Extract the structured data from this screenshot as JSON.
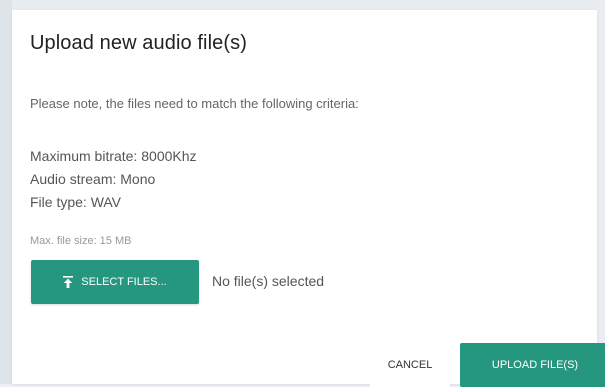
{
  "dialog": {
    "title": "Upload new audio file(s)",
    "note": "Please note, the files need to match the following criteria:",
    "criteria": [
      "Maximum bitrate: 8000Khz",
      "Audio stream: Mono",
      "File type: WAV"
    ],
    "max_size": "Max. file size: 15 MB",
    "select_button_label": "SELECT FILES...",
    "select_button_icon": "upload-icon",
    "no_files_text": "No file(s) selected",
    "cancel_label": "CANCEL",
    "upload_label": "UPLOAD FILE(S)"
  },
  "colors": {
    "accent": "#25977f"
  }
}
